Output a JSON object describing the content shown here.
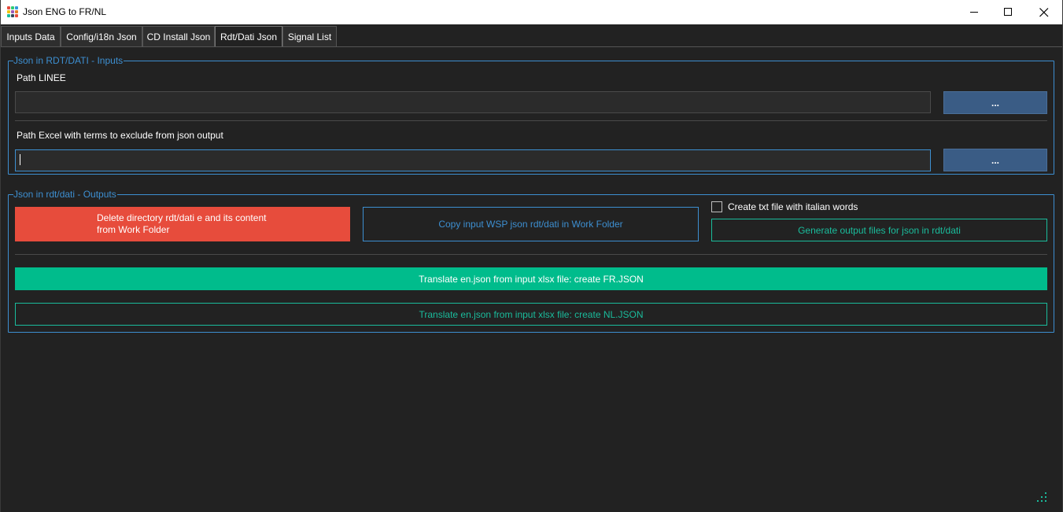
{
  "window": {
    "title": "Json ENG to FR/NL",
    "minimize_icon": "minimize-icon",
    "maximize_icon": "maximize-icon",
    "close_icon": "close-icon"
  },
  "tabs": [
    {
      "label": "Inputs Data",
      "active": false
    },
    {
      "label": "Config/i18n Json",
      "active": false
    },
    {
      "label": "CD Install Json",
      "active": false
    },
    {
      "label": "Rdt/Dati Json",
      "active": true
    },
    {
      "label": "Signal List",
      "active": false
    }
  ],
  "inputs_group": {
    "title": "Json in RDT/DATI - Inputs",
    "path_linee": {
      "label": "Path LINEE",
      "value": "",
      "browse_label": "..."
    },
    "path_excel": {
      "label": "Path Excel with terms to exclude from json output",
      "value": "",
      "browse_label": "..."
    }
  },
  "outputs_group": {
    "title": "Json in rdt/dati - Outputs",
    "delete_button": {
      "line1": "Delete directory rdt/dati e and its content",
      "line2": "from Work Folder"
    },
    "copy_button": "Copy input WSP json rdt/dati in Work Folder",
    "checkbox_label": "Create txt file with italian words",
    "checkbox_checked": false,
    "generate_button": "Generate output files for json in rdt/dati",
    "translate_fr_button": "Translate en.json from input xlsx file: create FR.JSON",
    "translate_nl_button": "Translate en.json from input xlsx file: create NL.JSON"
  },
  "colors": {
    "background": "#222222",
    "accent_blue": "#3d8fd1",
    "danger": "#e74c3c",
    "success": "#00bc8c",
    "browse_button": "#3a5c85"
  }
}
